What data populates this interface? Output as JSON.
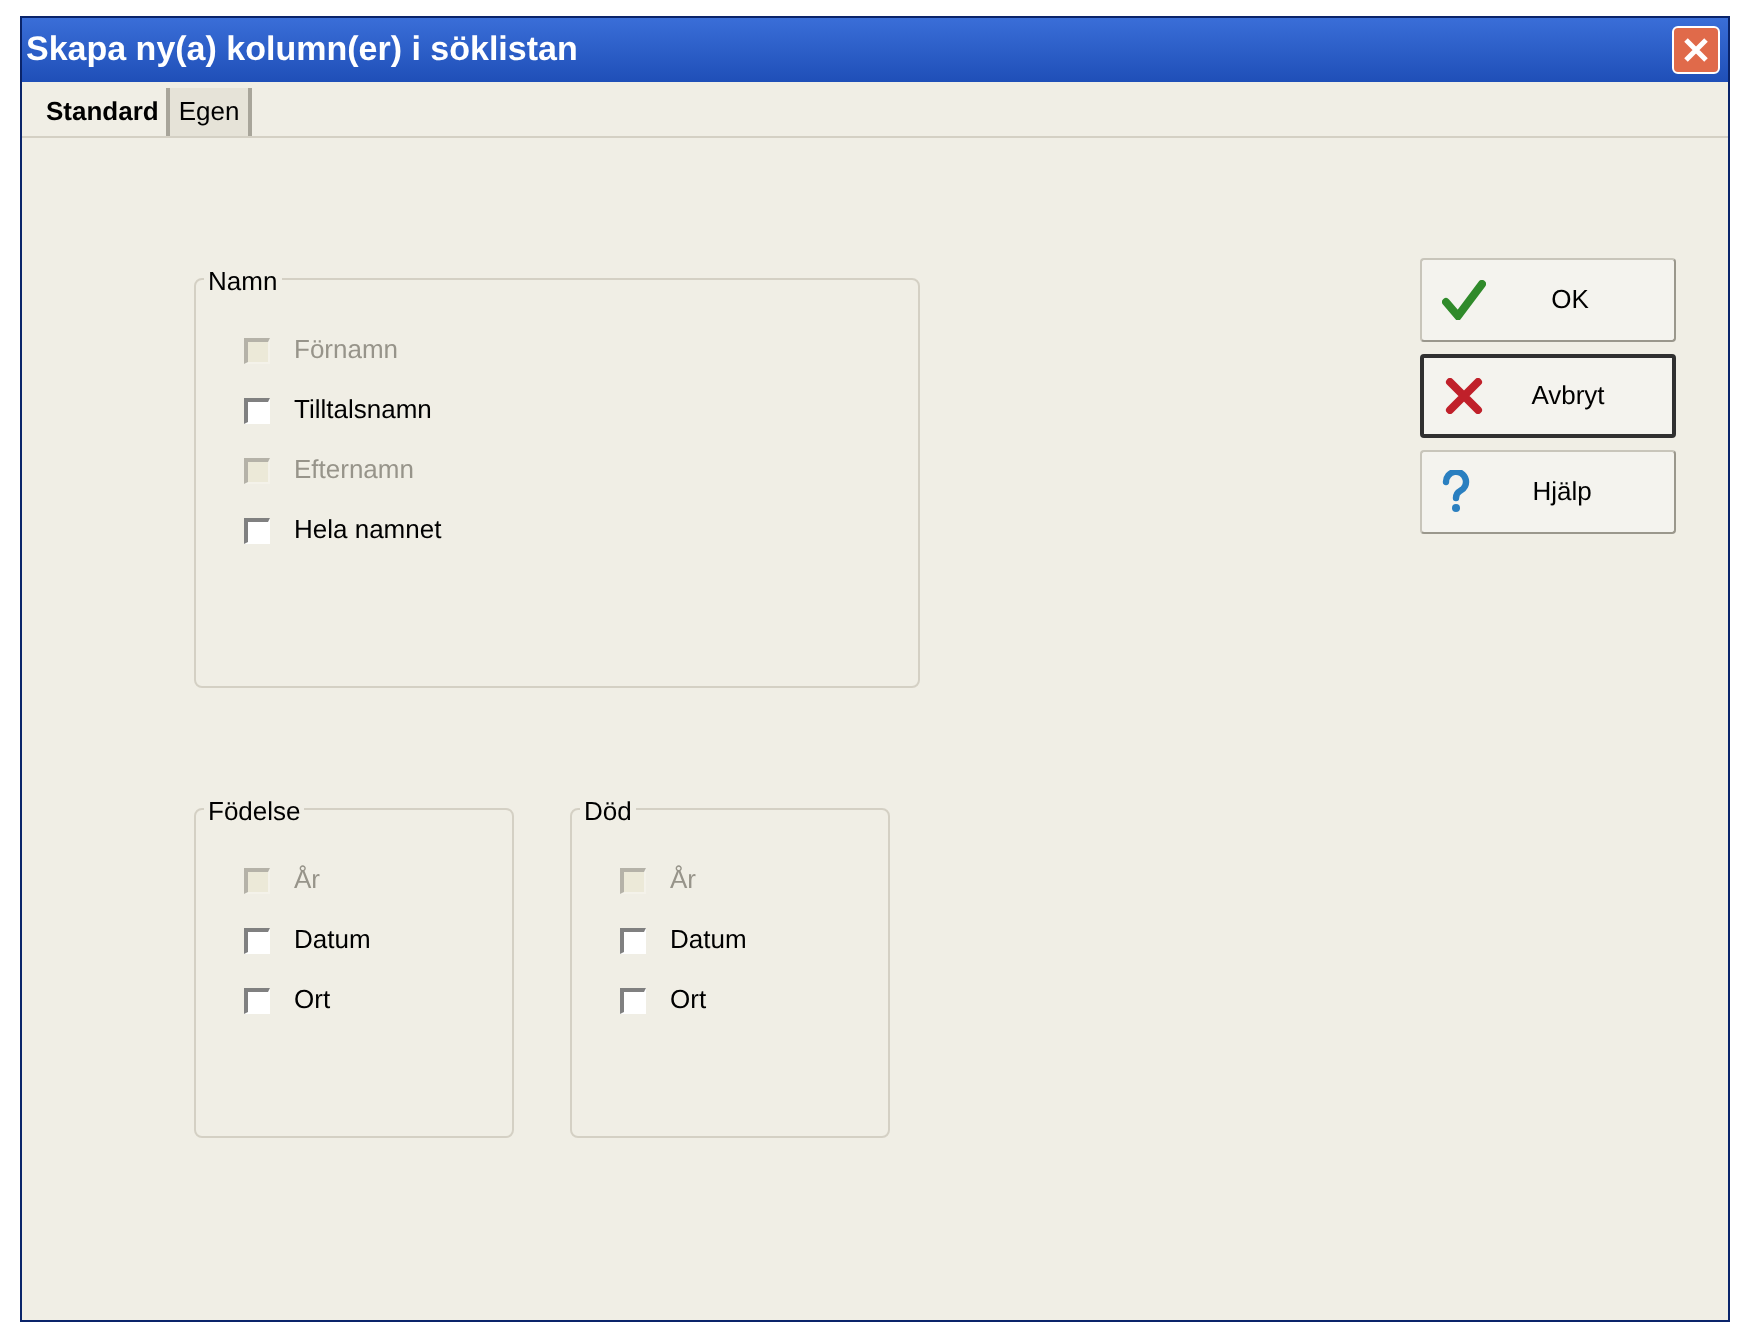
{
  "window": {
    "title": "Skapa ny(a) kolumn(er) i söklistan"
  },
  "tabs": [
    {
      "label": "Standard",
      "selected": true
    },
    {
      "label": "Egen",
      "selected": false
    }
  ],
  "groups": [
    {
      "title": "Namn",
      "items": [
        {
          "label": "Förnamn",
          "checked": false,
          "disabled": true
        },
        {
          "label": "Tilltalsnamn",
          "checked": false,
          "disabled": false
        },
        {
          "label": "Efternamn",
          "checked": false,
          "disabled": true
        },
        {
          "label": "Hela namnet",
          "checked": false,
          "disabled": false
        }
      ]
    },
    {
      "title": "Födelse",
      "items": [
        {
          "label": "År",
          "checked": false,
          "disabled": true
        },
        {
          "label": "Datum",
          "checked": false,
          "disabled": false
        },
        {
          "label": "Ort",
          "checked": false,
          "disabled": false
        }
      ]
    },
    {
      "title": "Död",
      "items": [
        {
          "label": "År",
          "checked": false,
          "disabled": true
        },
        {
          "label": "Datum",
          "checked": false,
          "disabled": false
        },
        {
          "label": "Ort",
          "checked": false,
          "disabled": false
        }
      ]
    }
  ],
  "buttons": [
    {
      "label": "OK",
      "kind": "ok",
      "focused": false
    },
    {
      "label": "Avbryt",
      "kind": "cancel",
      "focused": true
    },
    {
      "label": "Hjälp",
      "kind": "help",
      "focused": false
    }
  ]
}
